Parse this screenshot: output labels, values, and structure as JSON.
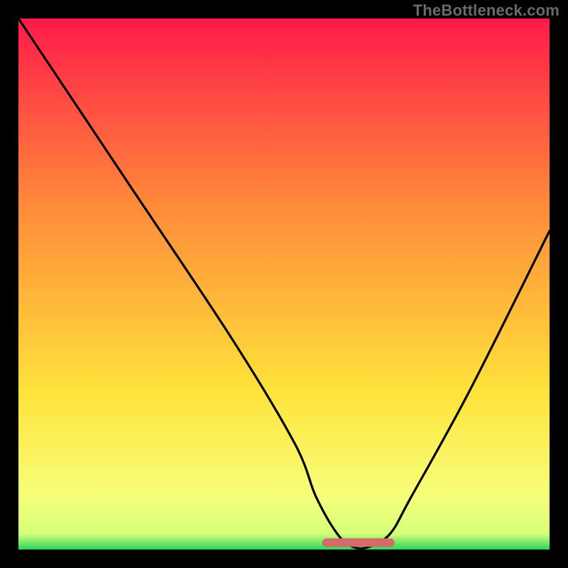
{
  "watermark": "TheBottleneck.com",
  "colors": {
    "top": "#ff1a4a",
    "mid_upper": "#ff8a3a",
    "mid_lower": "#ffe23a",
    "near_bottom": "#f6ff7a",
    "bottom_band": "#2bd65c",
    "curve": "#000000",
    "marker": "#d46a6a",
    "background": "#000000"
  },
  "chart_data": {
    "type": "line",
    "title": "",
    "xlabel": "",
    "ylabel": "",
    "x": [
      0,
      20,
      40,
      52,
      56,
      60,
      63,
      66,
      70,
      74,
      85,
      100
    ],
    "values": [
      100,
      70,
      40,
      20,
      10,
      3,
      0.5,
      0.5,
      3,
      10,
      30,
      60
    ],
    "ylim": [
      0,
      100
    ],
    "xlim": [
      0,
      100
    ],
    "flat_minimum_range_x": [
      58,
      70
    ],
    "marker_points_x": [
      58,
      70
    ]
  }
}
